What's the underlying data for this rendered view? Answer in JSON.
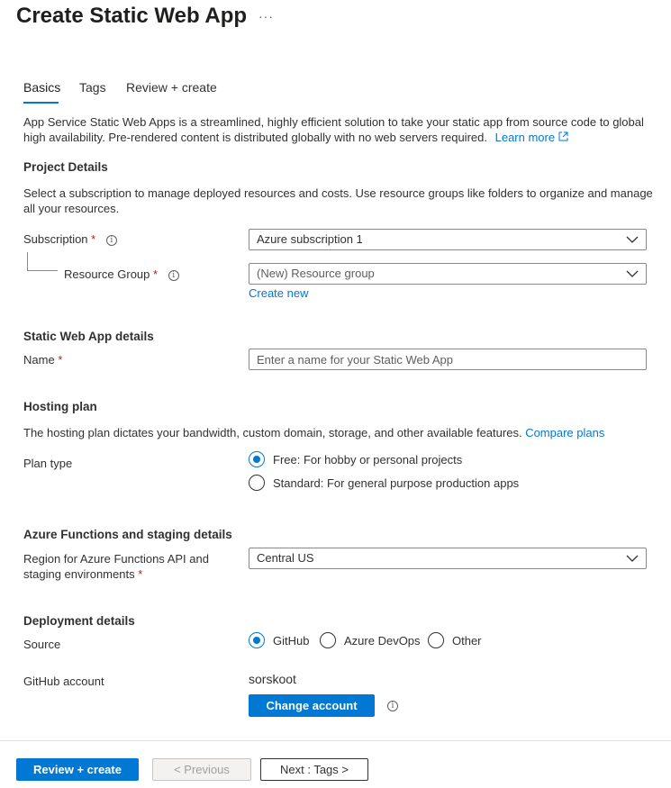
{
  "header": {
    "title": "Create Static Web App",
    "more": "···"
  },
  "tabs": [
    {
      "label": "Basics"
    },
    {
      "label": "Tags"
    },
    {
      "label": "Review + create"
    }
  ],
  "intro": {
    "text": "App Service Static Web Apps is a streamlined, highly efficient solution to take your static app from source code to global high availability. Pre-rendered content is distributed globally with no web servers required.",
    "learn_more": "Learn more"
  },
  "project_details": {
    "heading": "Project Details",
    "description": "Select a subscription to manage deployed resources and costs. Use resource groups like folders to organize and manage all your resources.",
    "subscription_label": "Subscription",
    "subscription_value": "Azure subscription 1",
    "resource_group_label": "Resource Group",
    "resource_group_value": "(New) Resource group",
    "create_new": "Create new"
  },
  "app_details": {
    "heading": "Static Web App details",
    "name_label": "Name",
    "name_placeholder": "Enter a name for your Static Web App",
    "name_value": ""
  },
  "hosting": {
    "heading": "Hosting plan",
    "description": "The hosting plan dictates your bandwidth, custom domain, storage, and other available features.",
    "compare_plans": "Compare plans",
    "plan_type_label": "Plan type",
    "options": [
      {
        "label": "Free: For hobby or personal projects",
        "selected": true
      },
      {
        "label": "Standard: For general purpose production apps",
        "selected": false
      }
    ]
  },
  "functions": {
    "heading": "Azure Functions and staging details",
    "region_label_line1": "Region for Azure Functions API and",
    "region_label_line2": "staging environments",
    "region_value": "Central US"
  },
  "deployment": {
    "heading": "Deployment details",
    "source_label": "Source",
    "sources": [
      {
        "label": "GitHub",
        "selected": true
      },
      {
        "label": "Azure DevOps",
        "selected": false
      },
      {
        "label": "Other",
        "selected": false
      }
    ],
    "github_account_label": "GitHub account",
    "github_account_value": "sorskoot",
    "change_account": "Change account"
  },
  "footer": {
    "review_create": "Review + create",
    "previous": "< Previous",
    "next": "Next : Tags >"
  },
  "colors": {
    "accent": "#0078d4",
    "required": "#a4262c",
    "text": "#323130"
  },
  "icons": [
    "more-icon",
    "external-link-icon",
    "info-icon",
    "chevron-down-icon"
  ]
}
